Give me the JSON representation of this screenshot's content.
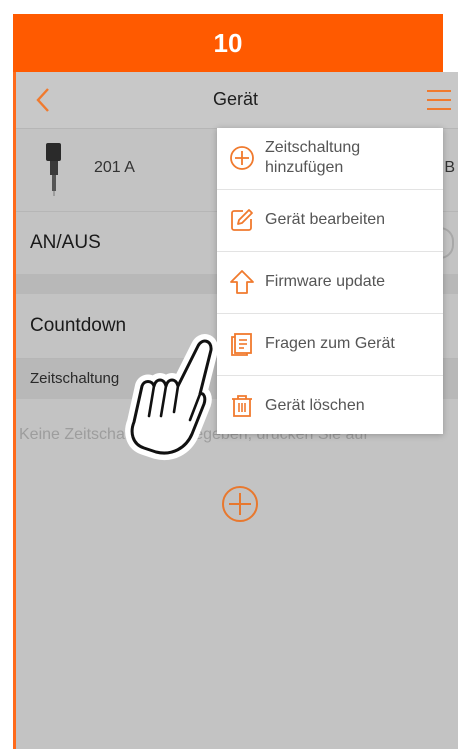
{
  "step_number": "10",
  "colors": {
    "accent": "#ff5a00",
    "icon": "#f07a2e"
  },
  "header": {
    "title": "Gerät",
    "back_icon": "chevron-left-icon",
    "menu_icon": "hamburger-menu-icon"
  },
  "device": {
    "name": "201 A",
    "trailing": "B",
    "icon": "plug-icon"
  },
  "switch": {
    "label": "AN/AUS"
  },
  "countdown": {
    "label": "Countdown"
  },
  "schedule": {
    "header": "Zeitschaltung",
    "empty_hint": "Keine Zeitschaltung eingegeben, drücken Sie auf",
    "add_icon": "plus-circle-icon"
  },
  "menu": {
    "items": [
      {
        "label": "Zeitschaltung hinzufügen",
        "line1": "Zeitschaltung",
        "line2": "hinzufügen",
        "icon": "plus-circle-icon"
      },
      {
        "label": "Gerät bearbeiten",
        "icon": "edit-icon"
      },
      {
        "label": "Firmware update",
        "icon": "upload-arrow-icon"
      },
      {
        "label": "Fragen zum Gerät",
        "icon": "document-icon"
      },
      {
        "label": "Gerät löschen",
        "icon": "trash-icon"
      }
    ]
  },
  "overlay": {
    "icon": "pointing-hand-icon"
  }
}
